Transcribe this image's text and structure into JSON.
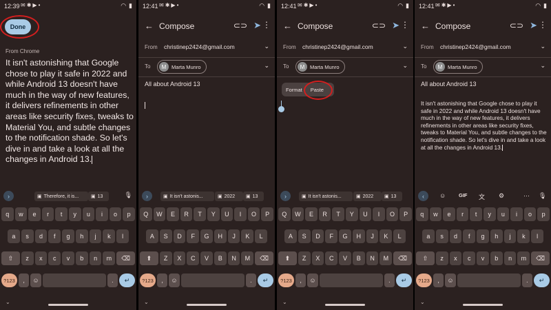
{
  "status": {
    "time1": "12:39",
    "time2": "12:41",
    "time3": "12:41",
    "time4": "12:41"
  },
  "screen1": {
    "done_label": "Done",
    "source_label": "From Chrome",
    "copied_text": "It isn't astonishing that Google chose to play it safe in 2022 and while Android 13 doesn't have much in the way of new features, it delivers refinements in other areas like security fixes, tweaks to Material You, and subtle changes to the notification shade. So let's dive in and take a look at all the changes in Android 13."
  },
  "compose": {
    "title": "Compose",
    "from_label": "From",
    "from_value": "christinep2424@gmail.com",
    "to_label": "To",
    "recipient_initial": "M",
    "recipient_name": "Marta Munro",
    "subject": "All about Android 13",
    "format_label": "Format",
    "paste_label": "Paste",
    "pasted_body": "It isn't astonishing that Google chose to play it safe in 2022 and while Android 13 doesn't have much in the way of new features, it delivers refinements in other areas like security fixes, tweaks to Material You, and subtle changes to the notification shade. So let's dive in and take a look at all the changes in Android 13."
  },
  "keyboard": {
    "suggest1_s1": "Therefore, it is...",
    "suggest2_s1": "13",
    "suggest1_s2": "It isn't astonis...",
    "suggest2_s2": "2022",
    "suggest3_s2": "13",
    "toolbar_gif": "GIF",
    "row1_lower": [
      "q",
      "w",
      "e",
      "r",
      "t",
      "y",
      "u",
      "i",
      "o",
      "p"
    ],
    "row2_lower": [
      "a",
      "s",
      "d",
      "f",
      "g",
      "h",
      "j",
      "k",
      "l"
    ],
    "row3_lower": [
      "z",
      "x",
      "c",
      "v",
      "b",
      "n",
      "m"
    ],
    "row1_upper": [
      "Q",
      "W",
      "E",
      "R",
      "T",
      "Y",
      "U",
      "I",
      "O",
      "P"
    ],
    "row2_upper": [
      "A",
      "S",
      "D",
      "F",
      "G",
      "H",
      "J",
      "K",
      "L"
    ],
    "row3_upper": [
      "Z",
      "X",
      "C",
      "V",
      "B",
      "N",
      "M"
    ],
    "num_label": "?123",
    "comma": ",",
    "period": ".",
    "emoji": "☺",
    "enter_glyph": "↵",
    "shift_glyph": "⇧",
    "shift_active_glyph": "⬆",
    "backspace_glyph": "⌫",
    "left_glyph": "‹"
  },
  "colors": {
    "background": "#2b2120",
    "key": "#4d4240",
    "accent": "#a9cbe6",
    "number_key": "#e5a98a",
    "highlight_ring": "#d31f1f"
  },
  "icons": [
    "back-arrow-icon",
    "attach-icon",
    "send-icon",
    "more-vert-icon",
    "chevron-down-icon",
    "mic-icon",
    "clipboard-icon",
    "settings-icon",
    "translate-icon",
    "emoji-icon",
    "wifi-icon",
    "battery-icon"
  ]
}
